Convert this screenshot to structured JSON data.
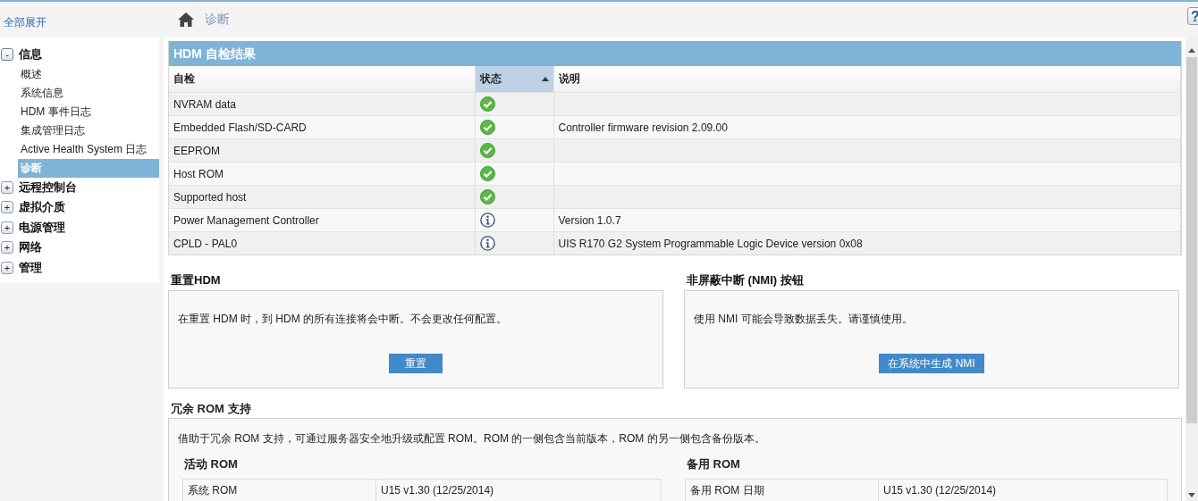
{
  "sidebar": {
    "expand_all": "全部展开",
    "tree": [
      {
        "toggle": "-",
        "label": "信息",
        "expanded": true,
        "children": [
          {
            "label": "概述",
            "selected": false
          },
          {
            "label": "系统信息",
            "selected": false
          },
          {
            "label": "HDM 事件日志",
            "selected": false
          },
          {
            "label": "集成管理日志",
            "selected": false
          },
          {
            "label": "Active Health System 日志",
            "selected": false
          },
          {
            "label": "诊断",
            "selected": true
          }
        ]
      },
      {
        "toggle": "+",
        "label": "远程控制台",
        "expanded": false
      },
      {
        "toggle": "+",
        "label": "虚拟介质",
        "expanded": false
      },
      {
        "toggle": "+",
        "label": "电源管理",
        "expanded": false
      },
      {
        "toggle": "+",
        "label": "网络",
        "expanded": false
      },
      {
        "toggle": "+",
        "label": "管理",
        "expanded": false
      }
    ]
  },
  "breadcrumb": "诊断",
  "help": "?",
  "self_test": {
    "title": "HDM 自检结果",
    "columns": [
      {
        "label": "自检",
        "sorted": false
      },
      {
        "label": "状态",
        "sorted": true
      },
      {
        "label": "说明",
        "sorted": false
      }
    ],
    "rows": [
      {
        "name": "NVRAM data",
        "kind": "ok"
      },
      {
        "name": "Embedded Flash/SD-CARD",
        "kind": "ok",
        "description": "Controller firmware revision 2.09.00"
      },
      {
        "name": "EEPROM",
        "kind": "ok"
      },
      {
        "name": "Host ROM",
        "kind": "ok"
      },
      {
        "name": "Supported host",
        "kind": "ok"
      },
      {
        "name": "Power Management Controller",
        "kind": "info",
        "description": "Version 1.0.7"
      },
      {
        "name": "CPLD - PAL0",
        "kind": "info",
        "description": "UIS R170 G2 System Programmable Logic Device version 0x08"
      }
    ]
  },
  "panels": [
    {
      "title": "重置HDM",
      "text": "在重置 HDM 时，到 HDM 的所有连接将会中断。不会更改任何配置。",
      "button": "重置"
    },
    {
      "title": "非屏蔽中断 (NMI) 按钮",
      "text": "使用 NMI 可能会导致数据丢失。请谨慎使用。",
      "button": "在系统中生成 NMI"
    }
  ],
  "redundant_rom": {
    "title": "冗余 ROM 支持",
    "text": "借助于冗余 ROM 支持，可通过服务器安全地升级或配置 ROM。ROM 的一侧包含当前版本，ROM 的另一侧包含备份版本。",
    "groups": [
      {
        "title": "活动 ROM",
        "rows": [
          {
            "label": "系统 ROM",
            "value": "U15 v1.30 (12/25/2014)"
          }
        ]
      },
      {
        "title": "备用 ROM",
        "rows": [
          {
            "label": "备用 ROM 日期",
            "value": "U15 v1.30 (12/25/2014)"
          }
        ]
      }
    ]
  }
}
